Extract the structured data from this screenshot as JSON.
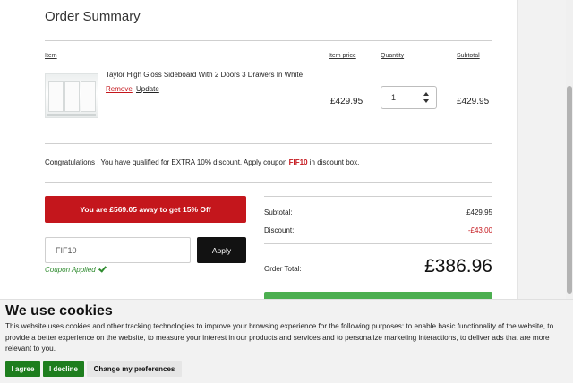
{
  "order": {
    "title": "Order Summary",
    "columns": {
      "item": "Item",
      "item_price": "Item price",
      "quantity": "Quantity",
      "subtotal": "Subtotal"
    },
    "line_item": {
      "name": "Taylor High Gloss Sideboard With 2 Doors 3 Drawers In White",
      "remove_label": "Remove",
      "update_label": "Update",
      "item_price": "£429.95",
      "quantity": "1",
      "subtotal": "£429.95"
    }
  },
  "promo": {
    "text_before": "Congratulations ! You have qualified for EXTRA 10% discount. Apply coupon ",
    "code": "FIF10",
    "text_after": " in discount box."
  },
  "upsell": {
    "label": "You are £569.05 away to get 15% Off"
  },
  "coupon": {
    "value": "FIF10",
    "apply_label": "Apply",
    "status": "Coupon Applied"
  },
  "totals": {
    "subtotal_label": "Subtotal:",
    "subtotal_value": "£429.95",
    "discount_label": "Discount:",
    "discount_value": "-£43.00",
    "order_total_label": "Order Total:",
    "order_total_value": "£386.96"
  },
  "cookie_banner": {
    "heading": "We use cookies",
    "body": "This website uses cookies and other tracking technologies to improve your browsing experience for the following purposes: to enable basic functionality of the website, to provide a better experience on the website, to measure your interest in our products and services and to personalize marketing interactions, to deliver ads that are more relevant to you.",
    "agree_label": "I agree",
    "decline_label": "I decline",
    "preferences_label": "Change my preferences"
  },
  "colors": {
    "accent_red": "#c4161c",
    "success_green": "#2e8b2e",
    "cookie_green": "#1e7e1e",
    "checkout_green": "#4caf50"
  }
}
